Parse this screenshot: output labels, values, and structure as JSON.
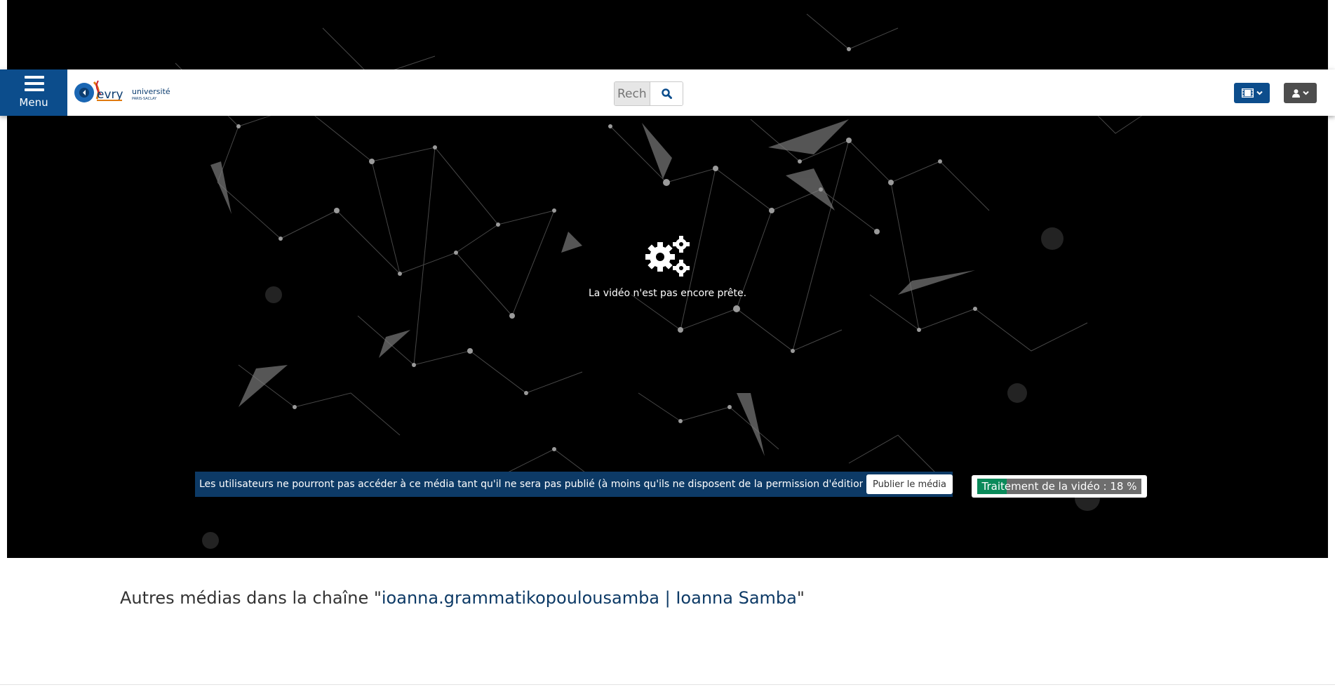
{
  "header": {
    "menu_label": "Menu",
    "logo_alt": "evry université PARIS-SACLAY",
    "search": {
      "placeholder": "Rechercher",
      "value": ""
    }
  },
  "player": {
    "status_text": "La vidéo n'est pas encore prête.",
    "publish_notice": "Les utilisateurs ne pourront pas accéder à ce média tant qu'il ne sera pas publié (à moins qu'ils ne disposent de la permission d'édition de celui ci).",
    "publish_button": "Publier le média",
    "processing": {
      "label": "Traitement de la vidéo : 18 %",
      "percent": 18
    }
  },
  "channel": {
    "prefix": "Autres médias dans la chaîne \"",
    "link": "ioanna.grammatikopoulousamba | Ioanna Samba",
    "suffix": "\""
  },
  "colors": {
    "brand_blue": "#0c4d8c",
    "notice_blue": "#0d3a66",
    "progress_green": "#0a8a5a",
    "user_button": "#4d4d4d"
  },
  "icons": {
    "menu": "hamburger-icon",
    "search": "search-icon",
    "media": "film-icon",
    "user": "user-icon",
    "processing": "gears-icon"
  }
}
